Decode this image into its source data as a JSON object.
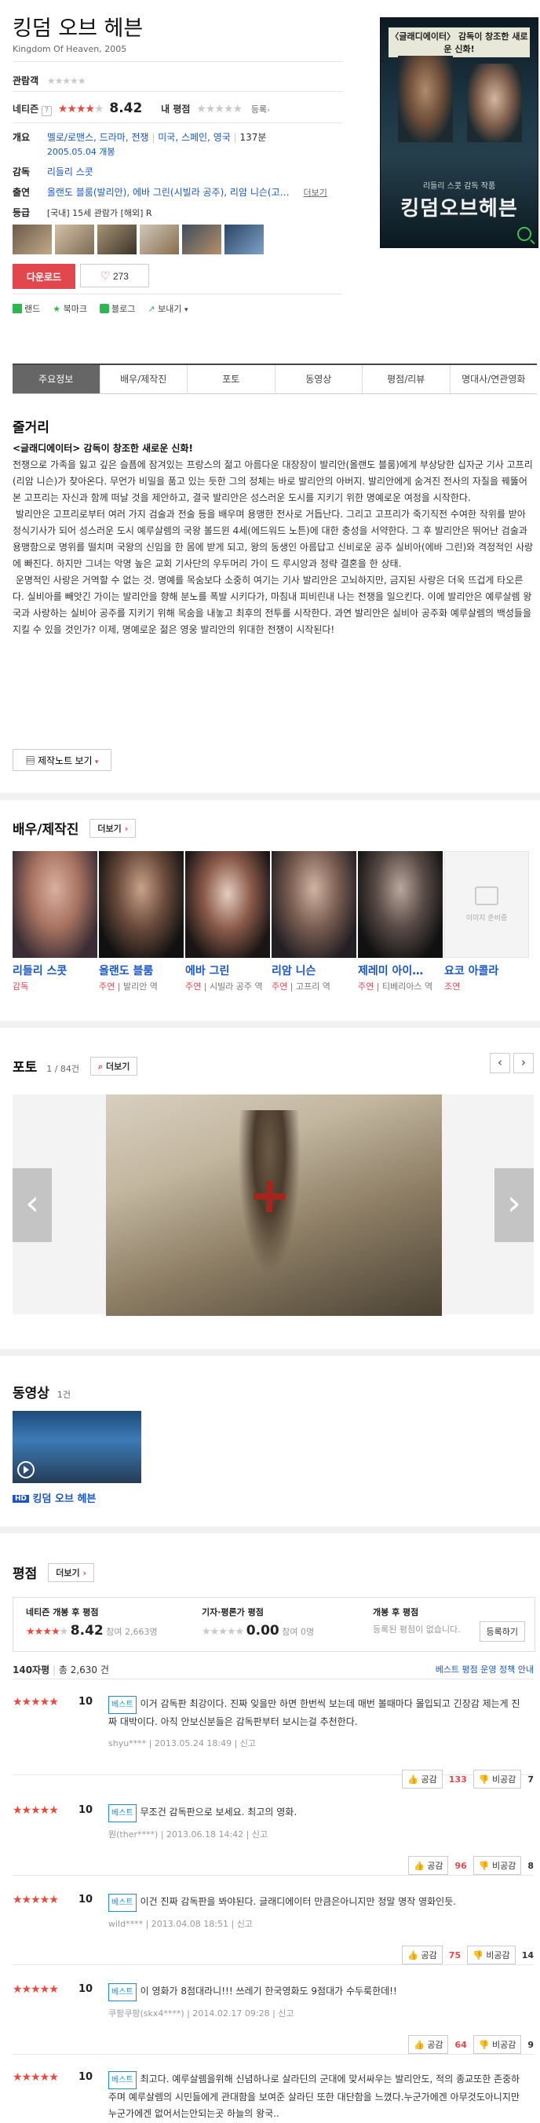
{
  "movie": {
    "title": "킹덤 오브 헤븐",
    "original_title": "Kingdom Of Heaven, 2005",
    "viewer_label": "관람객",
    "netizen_label": "네티즌",
    "netizen_score": "8.42",
    "my_rating_label": "내 평점",
    "register_label": "등록",
    "overview_label": "개요",
    "genres": "멜로/로맨스, 드라마, 전쟁",
    "countries": "미국, 스페인, 영국",
    "runtime": "137분",
    "release": "2005.05.04 개봉",
    "director_label": "감독",
    "director": "리들리 스콧",
    "cast_label": "출연",
    "cast_line": "올랜도 블룸(발리안), 에바 그린(시빌라 공주), 리암 니슨(고…",
    "more_label": "더보기",
    "grade_label": "등급",
    "grade": "[국내] 15세 관람가 [해외] R"
  },
  "poster": {
    "tagline": "〈글래디에이터〉 감독이 창조한 새로운 신화!",
    "director_line": "리들리 스콧 감독 작품",
    "title": "킹덤오브헤븐"
  },
  "actions": {
    "download": "다운로드",
    "like_count": "273",
    "share_items": [
      "랜드",
      "북마크",
      "블로그",
      "보내기"
    ]
  },
  "tabs": [
    "주요정보",
    "배우/제작진",
    "포토",
    "동영상",
    "평점/리뷰",
    "명대사/연관영화"
  ],
  "synopsis": {
    "heading": "줄거리",
    "lead": "<글래디에이터> 감독이 창조한 새로운 신화!",
    "p1": "전쟁으로 가족을 잃고 깊은 슬픔에 잠겨있는 프랑스의 젊고 아름다운 대장장이 발리안(올랜도 블룸)에게 부상당한 십자군 기사 고프리(리암 니슨)가 찾아온다. 무언가 비밀을 품고 있는 듯한 그의 정체는 바로 발리안의 아버지. 발리안에게 숨겨진 전사의 자질을 꿰뚫어본 고프리는 자신과 함께 떠날 것을 제안하고, 결국 발리안은 성스러운 도시를 지키기 위한 명예로운 여정을 시작한다.",
    "p2": "발리안은 고프리로부터 여러 가지 검술과 전술 등을 배우며 용맹한 전사로 거듭난다. 그리고 고프리가 죽기직전 수여한 작위를 받아 정식기사가 되어 성스러운 도시 예루살렘의 국왕 볼드윈 4세(에드워드 노튼)에 대한 충성을 서약한다. 그 후 발리안은 뛰어난 검술과 용맹함으로 명위를 떨치며 국왕의 신임을 한 몸에 받게 되고, 왕의 동생인 아름답고 신비로운 공주 실비아(에바 그린)와 격정적인 사랑에 빠진다. 하지만 그녀는 악명 높은 교회 기사단의 우두머리 가이 드 루시앙과 정략 결혼을 한 상태.",
    "p3": "운명적인 사랑은 거역할 수 없는 것. 명예를 목숨보다 소중히 여기는 기사 발리안은 고뇌하지만, 금지된 사랑은 더욱 뜨겁게 타오른다. 실비아를 빼앗긴 가이는 발리안을 향해 분노를 폭발 시키다가, 마침내 피비린내 나는 전쟁을 일으킨다. 이에 발리안은 예루살렘 왕국과 사랑하는 실비아 공주를 지키기 위해 목숨을 내놓고 최후의 전투를 시작한다. 과연 발리안은 실비아 공주화 예루살렘의 백성들을 지킬 수 있을 것인가? 이제, 명예로운 젊은 영웅 발리안의 위대한 전쟁이 시작된다!",
    "note_button": "제작노트 보기"
  },
  "cast_section": {
    "heading": "배우/제작진",
    "more": "더보기",
    "members": [
      {
        "name": "리들리 스콧",
        "role_type": "감독",
        "role": ""
      },
      {
        "name": "올랜도 블룸",
        "role_type": "주연",
        "role": "발리안 역"
      },
      {
        "name": "에바 그린",
        "role_type": "주연",
        "role": "시빌라 공주 역"
      },
      {
        "name": "리암 니슨",
        "role_type": "주연",
        "role": "고프리 역"
      },
      {
        "name": "제레미 아이…",
        "role_type": "주연",
        "role": "티베리아스 역"
      },
      {
        "name": "요코 아콜라",
        "role_type": "조연",
        "role": ""
      }
    ],
    "placeholder_text": "이미지 준비중"
  },
  "photo_section": {
    "heading": "포토",
    "counter": "1 / 84건",
    "more": "더보기"
  },
  "video_section": {
    "heading": "동영상",
    "count": "1건",
    "badge": "HD",
    "title": "킹덤 오브 헤븐"
  },
  "rating_section": {
    "heading": "평점",
    "more": "더보기",
    "netizen_title": "네티즌 개봉 후 평점",
    "netizen_score": "8.42",
    "netizen_count": "참여 2,663명",
    "critic_title": "기자·평론가 평점",
    "critic_score": "0.00",
    "critic_count": "참여 0명",
    "pre_title": "개봉 후 평점",
    "pre_note": "등록된 평점이 없습니다.",
    "register_btn": "등록하기",
    "total_label": "140자평",
    "total_count": "총 2,630 건",
    "policy_link": "베스트 평점 운영 정책 안내"
  },
  "reviews": [
    {
      "score": "10",
      "badge": "베스트",
      "text": "이거 감독판 최강이다. 진짜 잊을만 하면 한번씩 보는데 매번 볼때마다 몰입되고 긴장감 제는게 진짜 대박이다. 아직 안보신분들은 감독판부터 보시는걸 추천한다.",
      "user": "shyu****",
      "date": "2013.05.24 18:49",
      "report": "신고",
      "likes": "133",
      "dislikes": "7"
    },
    {
      "score": "10",
      "badge": "베스트",
      "text": "무조건 감독판으로 보세요. 최고의 영화.",
      "user": "뭔(ther****)",
      "date": "2013.06.18 14:42",
      "report": "신고",
      "likes": "96",
      "dislikes": "8"
    },
    {
      "score": "10",
      "badge": "베스트",
      "text": "이건 진짜 감독판을 봐야된다. 글래디에이터 만큼은아니지만 정말 명작 영화인듯.",
      "user": "wild****",
      "date": "2013.04.08 18:51",
      "report": "신고",
      "likes": "75",
      "dislikes": "14"
    },
    {
      "score": "10",
      "badge": "베스트",
      "text": "이 영화가 8점대라니!!! 쓰레기 한국영화도 9점대가 수두룩한데!!",
      "user": "쿠팡쿠팡(skx4****)",
      "date": "2014.02.17 09:28",
      "report": "신고",
      "likes": "64",
      "dislikes": "9"
    },
    {
      "score": "10",
      "badge": "베스트",
      "text": "최고다. 예루살렘을위해 신념하나로 살라딘의 군대에 맞서싸우는 발리안도, 적의 종교또한 존중하주며 예루살렘의 시민들에게 관대함을 보여준 살라딘 또한 대단함을 느꼈다.누군가에겐 아무것도아니지만 누군가에겐 없어서는안되는곳 하늘의 왕국..",
      "user": "",
      "date": "",
      "report": "",
      "likes": "",
      "dislikes": ""
    }
  ],
  "vote_labels": {
    "like": "공감",
    "dislike": "비공감"
  }
}
